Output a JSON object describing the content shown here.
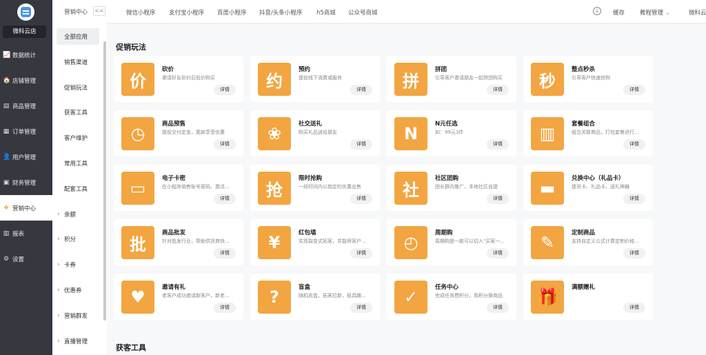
{
  "sidebar": {
    "shop_name": "微科云店",
    "items": [
      {
        "label": "数据统计",
        "icon": "chart-icon",
        "glyph": "📈"
      },
      {
        "label": "店铺管理",
        "icon": "store-icon",
        "glyph": "🏠"
      },
      {
        "label": "商品管理",
        "icon": "goods-icon",
        "glyph": "▤"
      },
      {
        "label": "订单管理",
        "icon": "order-icon",
        "glyph": "▦"
      },
      {
        "label": "用户管理",
        "icon": "user-icon",
        "glyph": "👤"
      },
      {
        "label": "财务管理",
        "icon": "finance-icon",
        "glyph": "▣"
      },
      {
        "label": "营销中心",
        "icon": "marketing-icon",
        "glyph": "❖"
      },
      {
        "label": "报表",
        "icon": "report-icon",
        "glyph": "▥"
      },
      {
        "label": "设置",
        "icon": "settings-icon",
        "glyph": "⚙"
      }
    ],
    "active_index": 6
  },
  "subsidebar": {
    "title": "营销中心",
    "collapse_label": "<<",
    "items": [
      {
        "label": "全部应用",
        "chevron": false
      },
      {
        "label": "销售渠道",
        "chevron": false
      },
      {
        "label": "促销玩法",
        "chevron": false
      },
      {
        "label": "获客工具",
        "chevron": false
      },
      {
        "label": "客户维护",
        "chevron": false
      },
      {
        "label": "常用工具",
        "chevron": false
      },
      {
        "label": "配套工具",
        "chevron": false
      },
      {
        "label": "余额",
        "chevron": true
      },
      {
        "label": "积分",
        "chevron": true
      },
      {
        "label": "卡券",
        "chevron": true
      },
      {
        "label": "优惠券",
        "chevron": true
      },
      {
        "label": "营销群发",
        "chevron": true
      },
      {
        "label": "直播管理",
        "chevron": true
      }
    ],
    "active_index": 0
  },
  "topbar": {
    "tabs": [
      "微信小程序",
      "支付宝小程序",
      "百度小程序",
      "抖音/头条小程序",
      "h5商城",
      "公众号商城"
    ],
    "cache": "缓存",
    "tutorial": "教程管理",
    "user": "微科云"
  },
  "main": {
    "section_title": "促销玩法",
    "next_section_title": "获客工具",
    "detail_label": "详情",
    "cards": [
      {
        "title": "砍价",
        "desc": "邀请好友砍价后低价购买",
        "icon": "bargain-icon",
        "glyph": "价"
      },
      {
        "title": "预约",
        "desc": "提前线下消费或服务",
        "icon": "reservation-icon",
        "glyph": "约"
      },
      {
        "title": "拼团",
        "desc": "引导客户邀请朋友一起拼团购买",
        "icon": "group-buy-icon",
        "glyph": "拼"
      },
      {
        "title": "整点秒杀",
        "desc": "引导客户快速抢购",
        "icon": "flash-sale-icon",
        "glyph": "秒"
      },
      {
        "title": "商品预售",
        "desc": "提前交付定金，尾款享受优惠",
        "icon": "presale-icon",
        "glyph": "◷"
      },
      {
        "title": "社交送礼",
        "desc": "购买礼品送给朋友",
        "icon": "social-gift-icon",
        "glyph": "❀"
      },
      {
        "title": "N元任选",
        "desc": "如：99元3件",
        "icon": "n-yuan-icon",
        "glyph": "N"
      },
      {
        "title": "套餐组合",
        "desc": "组合关联商品，打包套餐进行...",
        "icon": "combo-icon",
        "glyph": "▥"
      },
      {
        "title": "电子卡密",
        "desc": "在小程序销售账号密码、激活...",
        "icon": "ecard-icon",
        "glyph": "▭"
      },
      {
        "title": "限时抢购",
        "desc": "一段时间内以指定的优惠出售",
        "icon": "limited-time-icon",
        "glyph": "抢"
      },
      {
        "title": "社区团购",
        "desc": "团长群内推广，本地社区自提",
        "icon": "community-icon",
        "glyph": "社"
      },
      {
        "title": "兑换中心（礼品卡）",
        "desc": "提货卡、礼品卡、送礼神器",
        "icon": "gift-card-icon",
        "glyph": "▬"
      },
      {
        "title": "商品批发",
        "desc": "针对批发行业，帮助供货商快...",
        "icon": "wholesale-icon",
        "glyph": "批"
      },
      {
        "title": "红包墙",
        "desc": "实现裂变式拓客，并能将客户...",
        "icon": "red-packet-icon",
        "glyph": "¥"
      },
      {
        "title": "周期购",
        "desc": "周期购是一款可以切入\"买家一...",
        "icon": "cycle-buy-icon",
        "glyph": "◴"
      },
      {
        "title": "定制商品",
        "desc": "支持自定义公式计算定制价格...",
        "icon": "custom-goods-icon",
        "glyph": "✎"
      },
      {
        "title": "邀请有礼",
        "desc": "老客户成功邀请新客户，新老...",
        "icon": "invite-gift-icon",
        "glyph": "♥"
      },
      {
        "title": "盲盒",
        "desc": "随机拆盒，拓客拉新，极具趣...",
        "icon": "blind-box-icon",
        "glyph": "?"
      },
      {
        "title": "任务中心",
        "desc": "完成任务攒积分，用积分换商品",
        "icon": "task-icon",
        "glyph": "✓"
      },
      {
        "title": "满额赠礼",
        "desc": "",
        "icon": "full-gift-icon",
        "glyph": "🎁"
      }
    ]
  },
  "colors": {
    "sidebar_bg": "#363840",
    "icon_orange": "#f2a541",
    "main_bg": "#f7f8fa"
  }
}
